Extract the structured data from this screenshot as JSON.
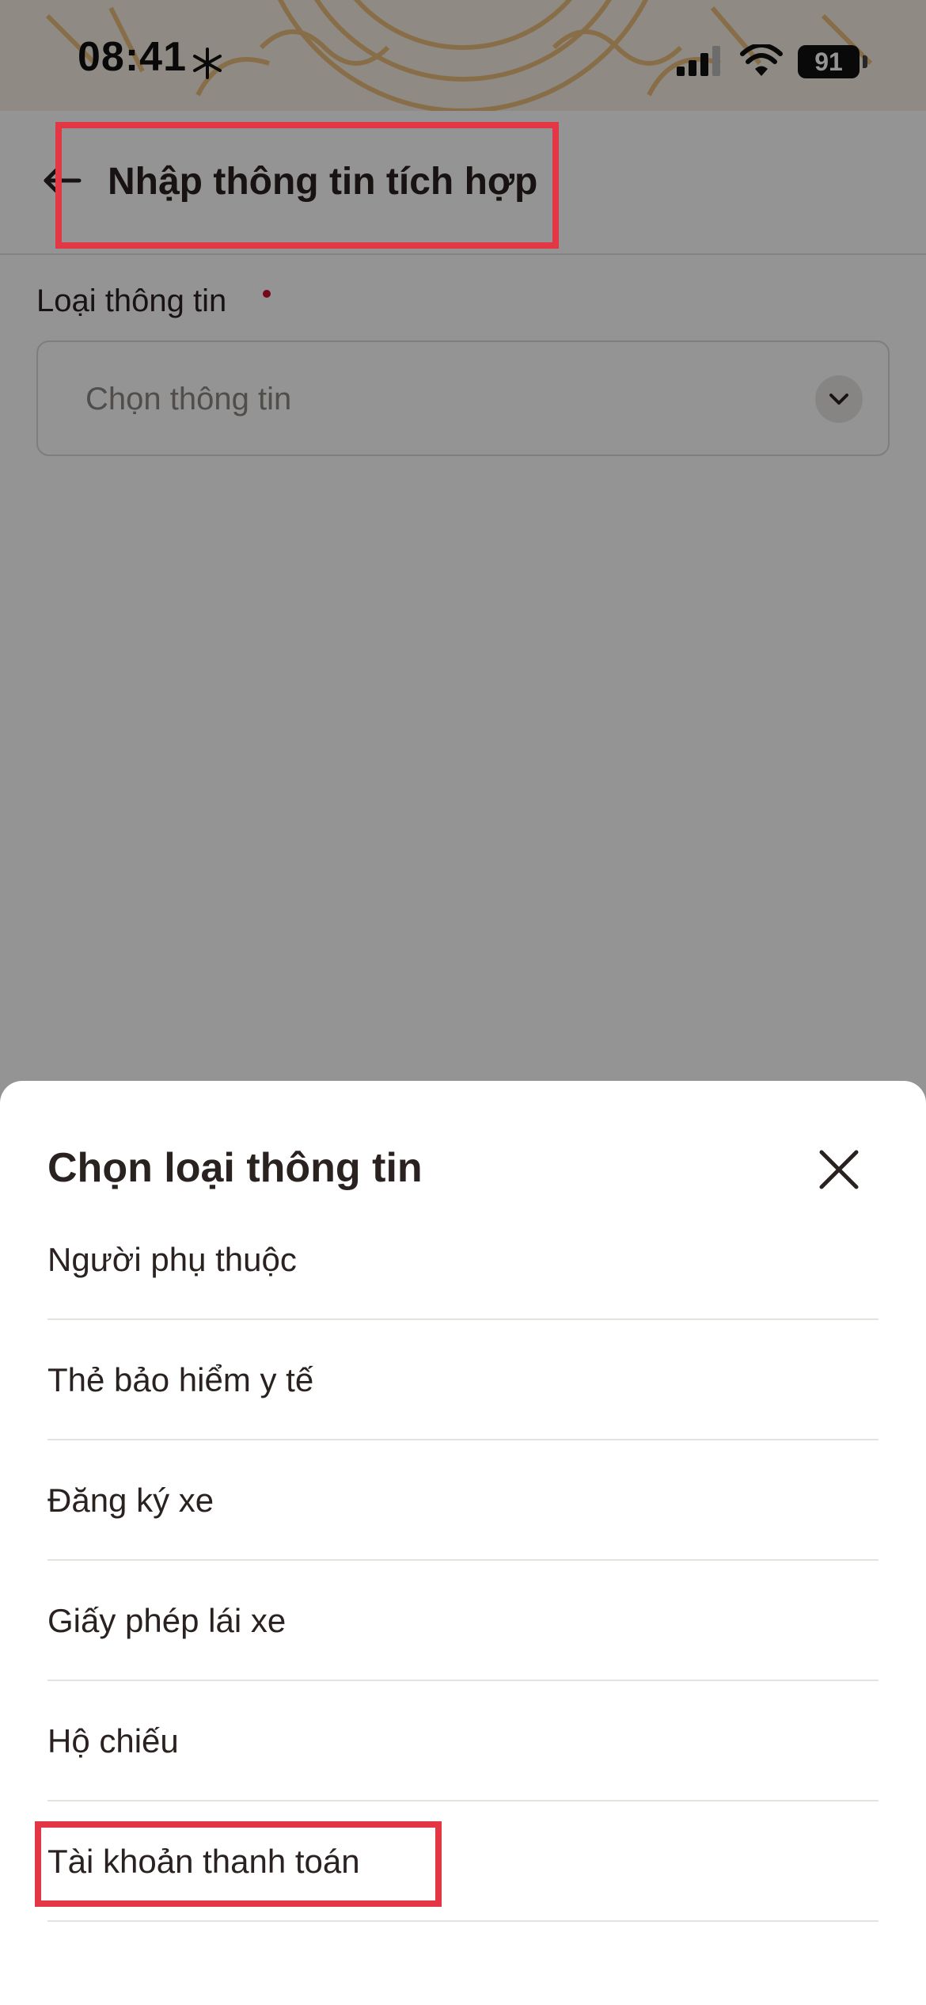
{
  "status_bar": {
    "time": "08:41",
    "battery": "91",
    "icons": [
      "snowflake-icon",
      "signal-icon",
      "wifi-icon",
      "battery-icon"
    ]
  },
  "header": {
    "title": "Nhập thông tin tích hợp",
    "back_icon": "arrow-left-icon"
  },
  "form": {
    "field_label": "Loại thông tin",
    "required": true,
    "select_placeholder": "Chọn thông tin",
    "select_icon": "chevron-down-icon"
  },
  "sheet": {
    "title": "Chọn loại thông tin",
    "close_icon": "close-icon",
    "options": [
      {
        "label": "Người phụ thuộc"
      },
      {
        "label": "Thẻ bảo hiểm y tế"
      },
      {
        "label": "Đăng ký xe"
      },
      {
        "label": "Giấy phép lái xe"
      },
      {
        "label": "Hộ chiếu"
      },
      {
        "label": "Tài khoản thanh toán"
      }
    ]
  },
  "colors": {
    "highlight": "#e33745",
    "required_dot": "#c8102e",
    "status_bg": "#f7efe4",
    "pattern": "#e9b56a"
  }
}
